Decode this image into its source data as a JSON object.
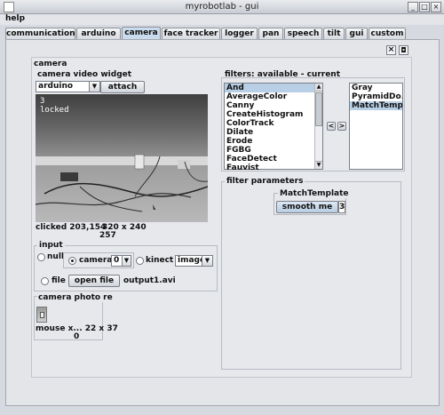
{
  "window": {
    "title": "myrobotlab - gui",
    "buttons": [
      "_",
      "□",
      "×"
    ]
  },
  "menu": {
    "help": "help"
  },
  "tabs": [
    {
      "label": "communication"
    },
    {
      "label": "arduino"
    },
    {
      "label": "camera"
    },
    {
      "label": "face tracker"
    },
    {
      "label": "logger"
    },
    {
      "label": "pan"
    },
    {
      "label": "speech"
    },
    {
      "label": "tilt"
    },
    {
      "label": "gui"
    },
    {
      "label": "custom"
    }
  ],
  "active_tab": "camera",
  "panel": {
    "title": "camera",
    "close_icon": "×",
    "detach_icon": "◘"
  },
  "video_widget": {
    "title": "camera  video widget",
    "source_select": "arduino",
    "attach_label": "attach",
    "overlay_line1": "3",
    "overlay_line2": "locked",
    "clicked_text": "clicked 203,154",
    "resolution_text": "320 x 240",
    "frame_count": "257"
  },
  "input": {
    "title": "input",
    "null_label": "null",
    "camera_label": "camera",
    "camera_index": "0",
    "kinect_label": "kinect",
    "kinect_mode": "image",
    "file_label": "file",
    "open_file_label": "open file",
    "filename": "output1.avi"
  },
  "photo": {
    "title": "camera  photo re",
    "mouse_text": "mouse x...  22 x 37",
    "count": "0"
  },
  "filters": {
    "title": "filters: available - current",
    "available": [
      "And",
      "AverageColor",
      "Canny",
      "CreateHistogram",
      "ColorTrack",
      "Dilate",
      "Erode",
      "FGBG",
      "FaceDetect",
      "Fauvist"
    ],
    "current": [
      "Gray",
      "PyramidDo...",
      "MatchTemp..."
    ],
    "left_arrow": "<",
    "right_arrow": ">"
  },
  "filter_params": {
    "title": "filter parameters",
    "filter_name": "MatchTemplate",
    "smooth_label": "smooth me",
    "smooth_value": "3"
  },
  "colors": {
    "selected_item": "#b8cfe5",
    "active_tab": "#c9dbec"
  }
}
